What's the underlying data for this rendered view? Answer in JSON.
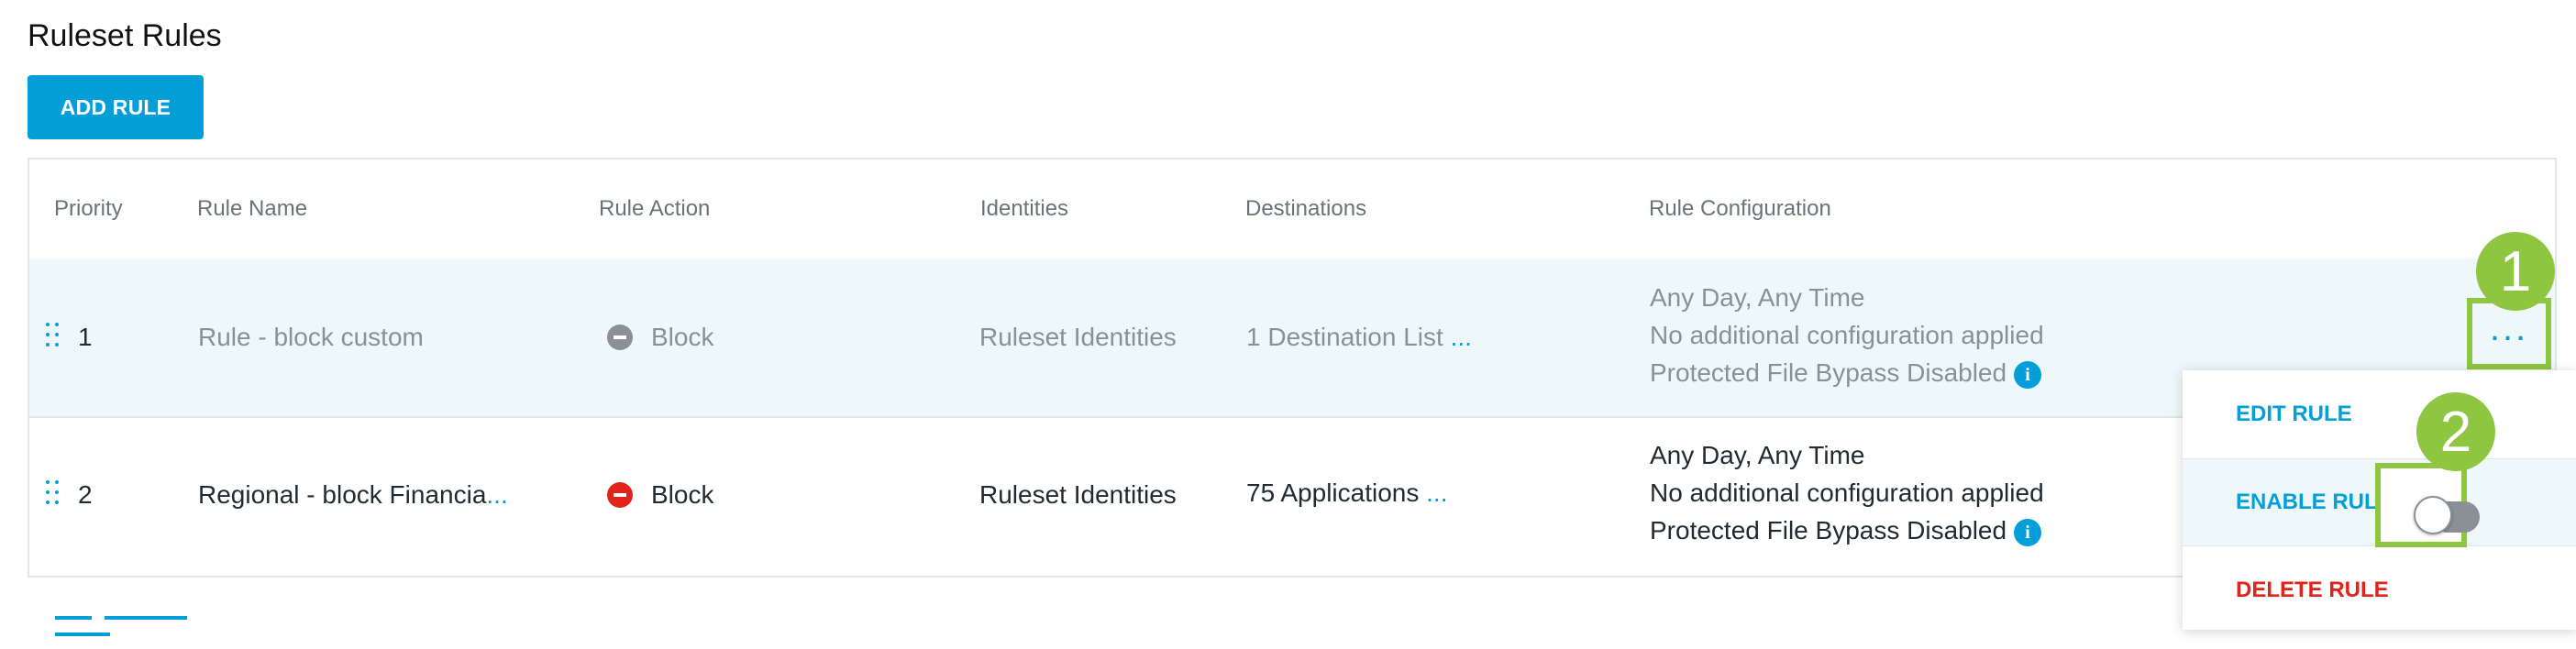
{
  "page": {
    "title": "Ruleset Rules",
    "add_rule_label": "ADD RULE"
  },
  "table": {
    "columns": [
      "Priority",
      "Rule Name",
      "Rule Action",
      "Identities",
      "Destinations",
      "Rule Configuration"
    ],
    "rows": [
      {
        "priority": "1",
        "rule_name": "Rule - block custom",
        "rule_action": "Block",
        "action_color": "#8a9196",
        "identities": "Ruleset Identities",
        "destinations": "1 Destination List",
        "destinations_more": "...",
        "config": [
          "Any Day, Any Time",
          "No additional configuration applied",
          "Protected File Bypass Disabled"
        ],
        "state": "disabled"
      },
      {
        "priority": "2",
        "rule_name": "Regional - block Financia",
        "rule_name_more": "...",
        "rule_action": "Block",
        "action_color": "#e2231a",
        "identities": "Ruleset Identities",
        "destinations": "75 Applications",
        "destinations_more": "...",
        "config": [
          "Any Day, Any Time",
          "No additional configuration applied",
          "Protected File Bypass Disabled"
        ],
        "state": "enabled"
      }
    ]
  },
  "row_menu": {
    "more_icon": "...",
    "items": [
      "EDIT RULE",
      "ENABLE RULE",
      "DELETE RULE"
    ],
    "enable_toggle_on": false
  },
  "callouts": [
    "1",
    "2"
  ],
  "icons": {
    "info": "i",
    "drag": "drag-handle-icon",
    "block": "block-icon"
  },
  "colors": {
    "accent": "#049fd9",
    "callout": "#8ec641",
    "danger": "#e2231a",
    "muted": "#8a9196"
  }
}
